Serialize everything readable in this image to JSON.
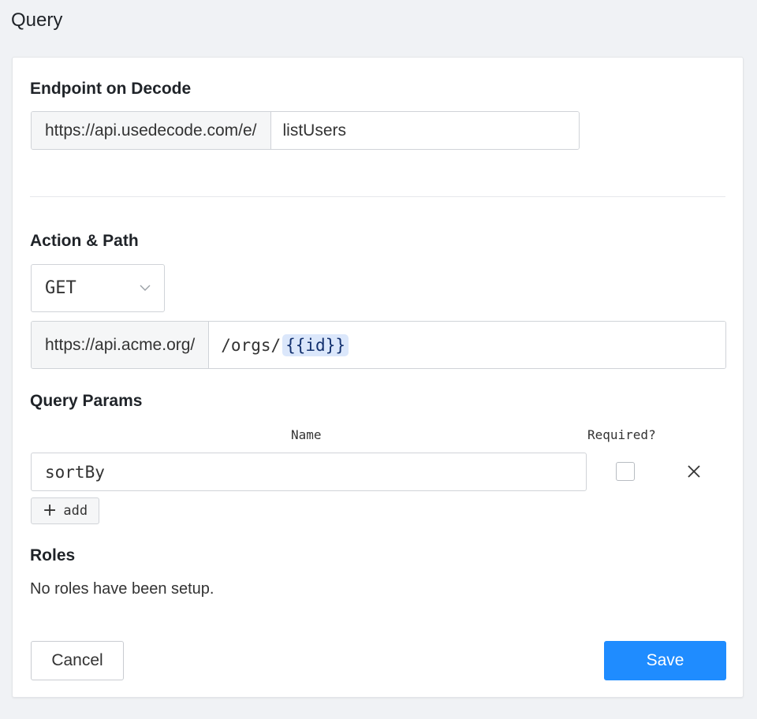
{
  "page": {
    "title": "Query"
  },
  "endpoint": {
    "heading": "Endpoint on Decode",
    "base_url": "https://api.usedecode.com/e/",
    "slug": "listUsers"
  },
  "action": {
    "heading": "Action & Path",
    "method": "GET",
    "base_url": "https://api.acme.org/",
    "path_prefix": "/orgs/",
    "path_token": "{{id}}"
  },
  "query_params": {
    "heading": "Query Params",
    "columns": {
      "name": "Name",
      "required": "Required?"
    },
    "rows": [
      {
        "name": "sortBy",
        "required": false
      }
    ],
    "add_label": "add"
  },
  "roles": {
    "heading": "Roles",
    "empty_text": "No roles have been setup."
  },
  "footer": {
    "cancel_label": "Cancel",
    "save_label": "Save"
  },
  "colors": {
    "primary": "#1f8cff",
    "token_bg": "#dbe7fb",
    "page_bg": "#f0f2f5"
  },
  "icons": [
    "chevron-down-icon",
    "close-icon",
    "plus-icon"
  ]
}
